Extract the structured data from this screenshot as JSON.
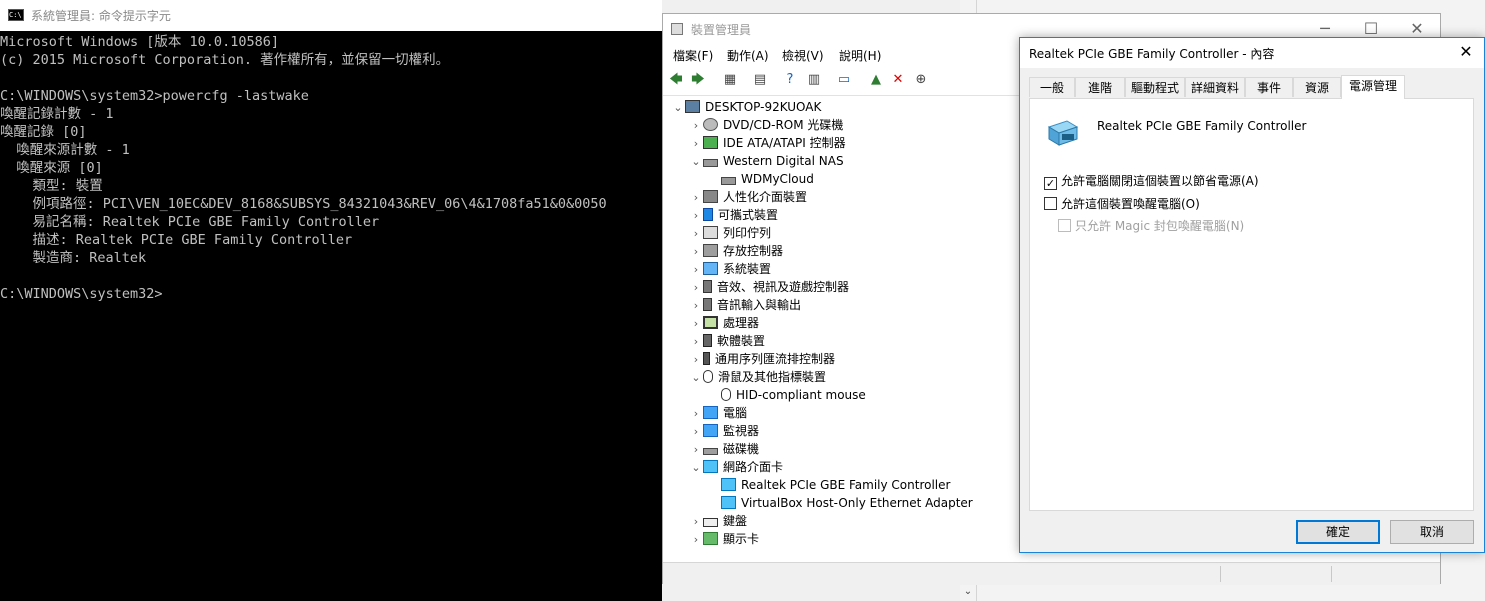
{
  "cmd": {
    "title": "系統管理員: 命令提示字元",
    "lines": [
      "Microsoft Windows [版本 10.0.10586]",
      "(c) 2015 Microsoft Corporation. 著作權所有，並保留一切權利。",
      "",
      "C:\\WINDOWS\\system32>powercfg -lastwake",
      "喚醒記錄計數 - 1",
      "喚醒記錄 [0]",
      "  喚醒來源計數 - 1",
      "  喚醒來源 [0]",
      "    類型: 裝置",
      "    例項路徑: PCI\\VEN_10EC&DEV_8168&SUBSYS_84321043&REV_06\\4&1708fa51&0&0050",
      "    易記名稱: Realtek PCIe GBE Family Controller",
      "    描述: Realtek PCIe GBE Family Controller",
      "    製造商: Realtek",
      "",
      "C:\\WINDOWS\\system32>"
    ]
  },
  "device_manager": {
    "title": "裝置管理員",
    "menu": [
      "檔案(F)",
      "動作(A)",
      "檢視(V)",
      "說明(H)"
    ],
    "tree": [
      {
        "label": "DESKTOP-92KUOAK",
        "level": 0,
        "exp": "v",
        "icon": "computer-icon"
      },
      {
        "label": "DVD/CD-ROM 光碟機",
        "level": 1,
        "exp": ">",
        "icon": "dvd-drive-icon"
      },
      {
        "label": "IDE ATA/ATAPI 控制器",
        "level": 1,
        "exp": ">",
        "icon": "ide-controller-icon"
      },
      {
        "label": "Western Digital NAS",
        "level": 1,
        "exp": "v",
        "icon": "nas-icon"
      },
      {
        "label": "WDMyCloud",
        "level": 2,
        "exp": "",
        "icon": "nas-icon"
      },
      {
        "label": "人性化介面裝置",
        "level": 1,
        "exp": ">",
        "icon": "hid-icon"
      },
      {
        "label": "可攜式裝置",
        "level": 1,
        "exp": ">",
        "icon": "portable-device-icon"
      },
      {
        "label": "列印佇列",
        "level": 1,
        "exp": ">",
        "icon": "printer-icon"
      },
      {
        "label": "存放控制器",
        "level": 1,
        "exp": ">",
        "icon": "storage-controller-icon"
      },
      {
        "label": "系統裝置",
        "level": 1,
        "exp": ">",
        "icon": "system-device-icon"
      },
      {
        "label": "音效、視訊及遊戲控制器",
        "level": 1,
        "exp": ">",
        "icon": "speaker-icon"
      },
      {
        "label": "音訊輸入與輸出",
        "level": 1,
        "exp": ">",
        "icon": "speaker-icon"
      },
      {
        "label": "處理器",
        "level": 1,
        "exp": ">",
        "icon": "processor-icon"
      },
      {
        "label": "軟體裝置",
        "level": 1,
        "exp": ">",
        "icon": "software-device-icon"
      },
      {
        "label": "通用序列匯流排控制器",
        "level": 1,
        "exp": ">",
        "icon": "usb-icon"
      },
      {
        "label": "滑鼠及其他指標裝置",
        "level": 1,
        "exp": "v",
        "icon": "mouse-icon"
      },
      {
        "label": "HID-compliant mouse",
        "level": 2,
        "exp": "",
        "icon": "mouse-icon"
      },
      {
        "label": "電腦",
        "level": 1,
        "exp": ">",
        "icon": "monitor-icon"
      },
      {
        "label": "監視器",
        "level": 1,
        "exp": ">",
        "icon": "monitor-icon"
      },
      {
        "label": "磁碟機",
        "level": 1,
        "exp": ">",
        "icon": "disk-drive-icon"
      },
      {
        "label": "網路介面卡",
        "level": 1,
        "exp": "v",
        "icon": "network-adapter-icon"
      },
      {
        "label": "Realtek PCIe GBE Family Controller",
        "level": 2,
        "exp": "",
        "icon": "network-adapter-icon"
      },
      {
        "label": "VirtualBox Host-Only Ethernet Adapter",
        "level": 2,
        "exp": "",
        "icon": "network-adapter-icon"
      },
      {
        "label": "鍵盤",
        "level": 1,
        "exp": ">",
        "icon": "keyboard-icon"
      },
      {
        "label": "顯示卡",
        "level": 1,
        "exp": ">",
        "icon": "display-adapter-icon"
      }
    ]
  },
  "properties": {
    "title": "Realtek PCIe GBE Family Controller - 內容",
    "tabs": [
      "一般",
      "進階",
      "驅動程式",
      "詳細資料",
      "事件",
      "資源",
      "電源管理"
    ],
    "active_tab": "電源管理",
    "device_name": "Realtek PCIe GBE Family Controller",
    "options": [
      {
        "label": "允許電腦關閉這個裝置以節省電源(A)",
        "checked": true,
        "enabled": true
      },
      {
        "label": "允許這個裝置喚醒電腦(O)",
        "checked": false,
        "enabled": true
      },
      {
        "label": "只允許 Magic 封包喚醒電腦(N)",
        "checked": false,
        "enabled": false
      }
    ],
    "ok_label": "確定",
    "cancel_label": "取消"
  }
}
